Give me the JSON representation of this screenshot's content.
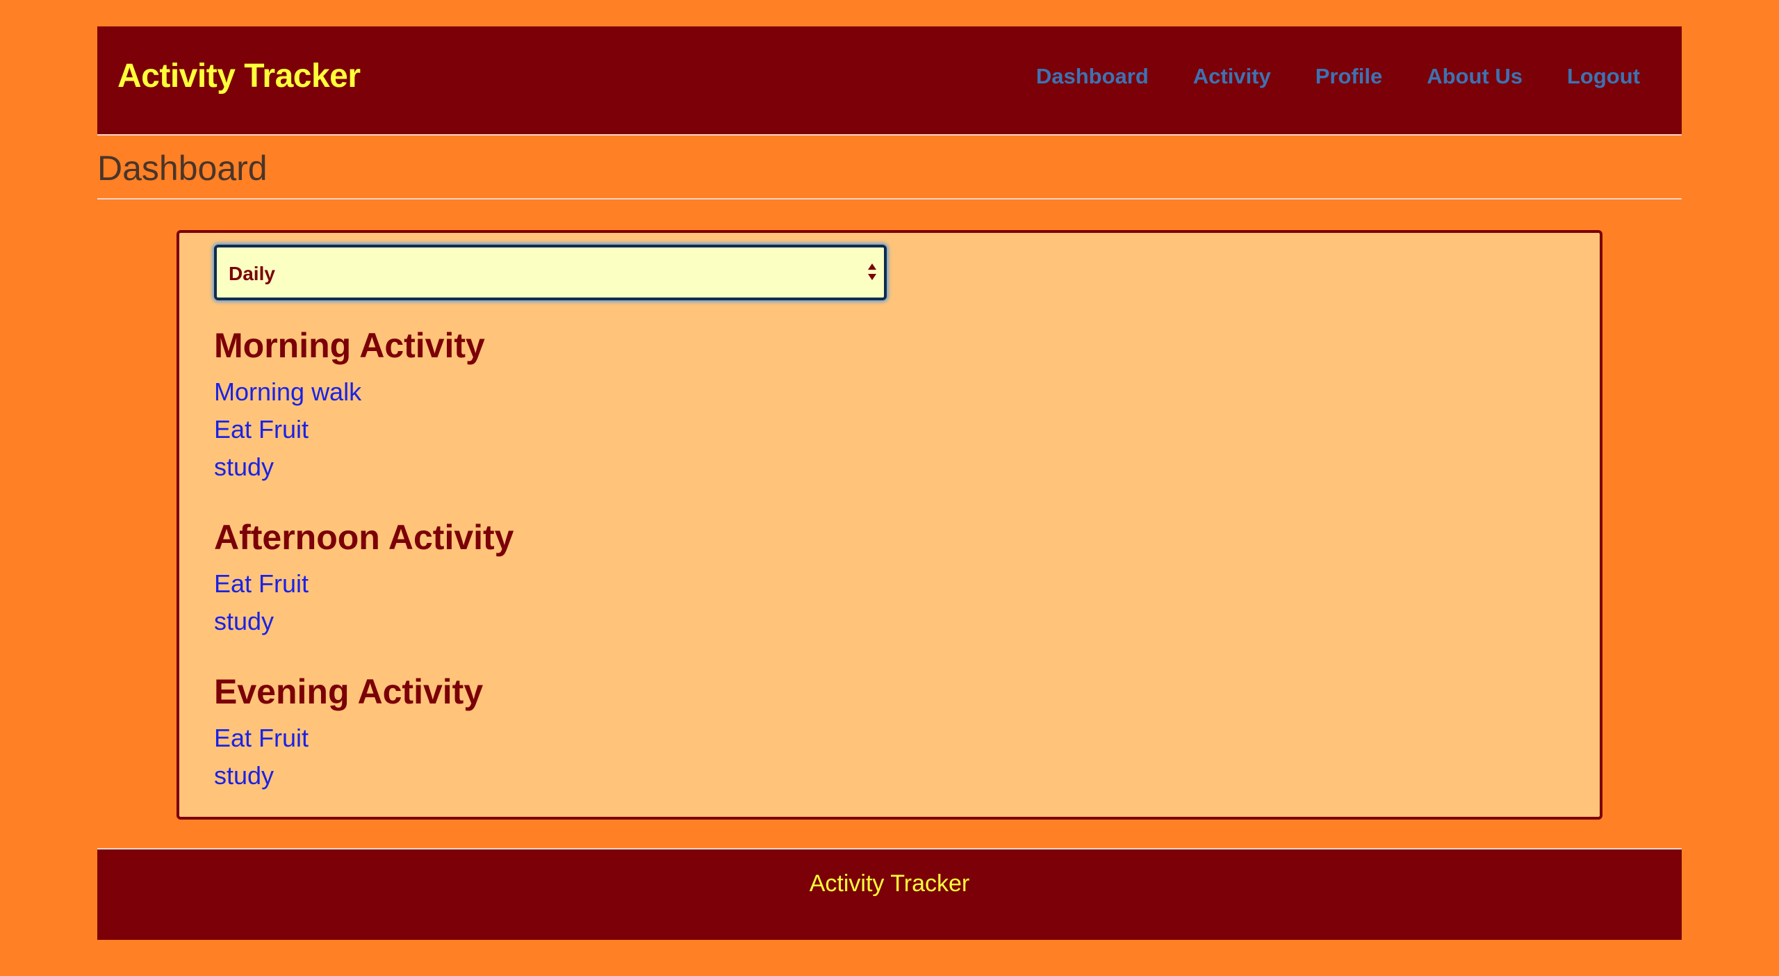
{
  "header": {
    "brand": "Activity Tracker",
    "nav": [
      "Dashboard",
      "Activity",
      "Profile",
      "About Us",
      "Logout"
    ]
  },
  "page_title": "Dashboard",
  "filter": {
    "selected": "Daily"
  },
  "sections": [
    {
      "title": "Morning Activity",
      "items": [
        "Morning walk",
        "Eat Fruit",
        "study"
      ]
    },
    {
      "title": "Afternoon Activity",
      "items": [
        "Eat Fruit",
        "study"
      ]
    },
    {
      "title": "Evening Activity",
      "items": [
        "Eat Fruit",
        "study"
      ]
    }
  ],
  "footer": {
    "text": "Activity Tracker"
  },
  "colors": {
    "page_bg": "#ff8025",
    "header_bg": "#7b0008",
    "brand": "#ffff3a",
    "nav_link": "#3c73b3",
    "card_bg": "#ffc479",
    "heading": "#7b0008",
    "list_item": "#1a22e6"
  }
}
